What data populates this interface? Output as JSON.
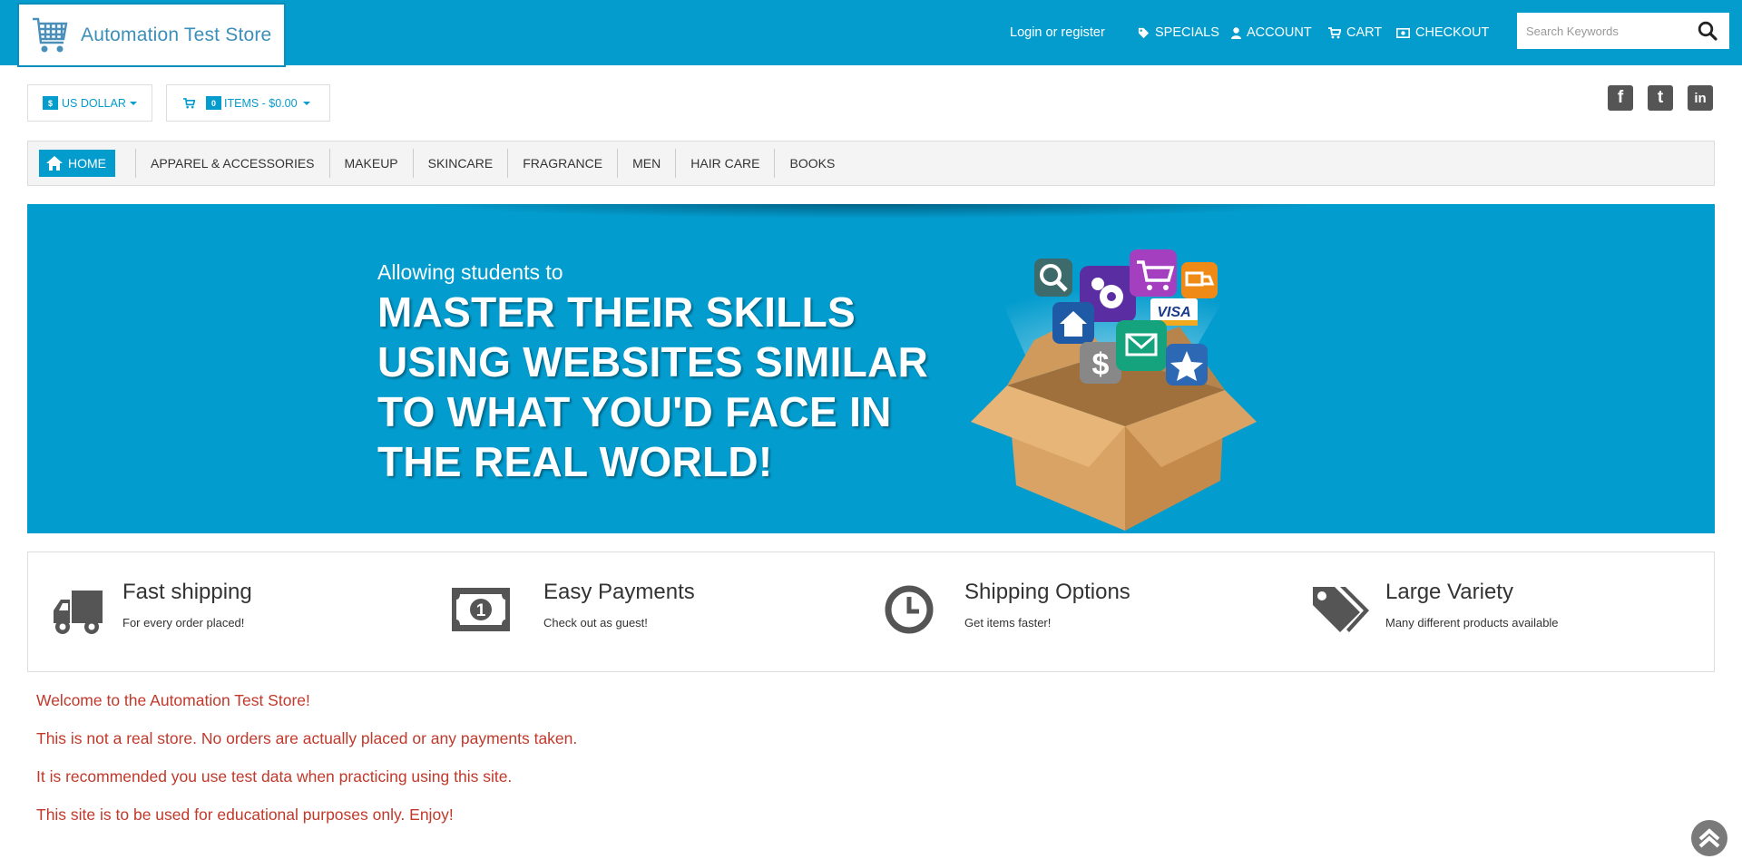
{
  "header": {
    "logo_text": "Automation Test Store",
    "login_link": "Login or register",
    "nav": [
      {
        "label": "SPECIALS",
        "icon": "tag-icon"
      },
      {
        "label": "ACCOUNT",
        "icon": "user-icon"
      },
      {
        "label": "CART",
        "icon": "cart-icon"
      },
      {
        "label": "CHECKOUT",
        "icon": "money-icon"
      }
    ],
    "search_placeholder": "Search Keywords",
    "search_value": ""
  },
  "toolbar": {
    "currency_symbol": "$",
    "currency_label": "US DOLLAR",
    "cart_count": "0",
    "cart_label": "ITEMS - $0.00"
  },
  "social": [
    "f",
    "t",
    "in"
  ],
  "categories": {
    "home": "HOME",
    "items": [
      "APPAREL & ACCESSORIES",
      "MAKEUP",
      "SKINCARE",
      "FRAGRANCE",
      "MEN",
      "HAIR CARE",
      "BOOKS"
    ]
  },
  "banner": {
    "small": "Allowing students to",
    "big": "MASTER THEIR SKILLS USING WEBSITES SIMILAR TO WHAT YOU'D FACE IN THE REAL WORLD!",
    "card_text": "VISA"
  },
  "features": [
    {
      "title": "Fast shipping",
      "subtitle": "For every order placed!",
      "icon": "truck-icon"
    },
    {
      "title": "Easy Payments",
      "subtitle": "Check out as guest!",
      "icon": "banknote-icon"
    },
    {
      "title": "Shipping Options",
      "subtitle": "Get items faster!",
      "icon": "clock-icon"
    },
    {
      "title": "Large Variety",
      "subtitle": "Many different products available",
      "icon": "tags-icon"
    }
  ],
  "welcome": [
    "Welcome to the Automation Test Store!",
    "This is not a real store. No orders are actually placed or any payments taken.",
    "It is recommended you use test data when practicing using this site.",
    "This site is to be used for educational purposes only. Enjoy!"
  ],
  "colors": {
    "brand": "#049ccd",
    "notice": "#c0392b"
  }
}
